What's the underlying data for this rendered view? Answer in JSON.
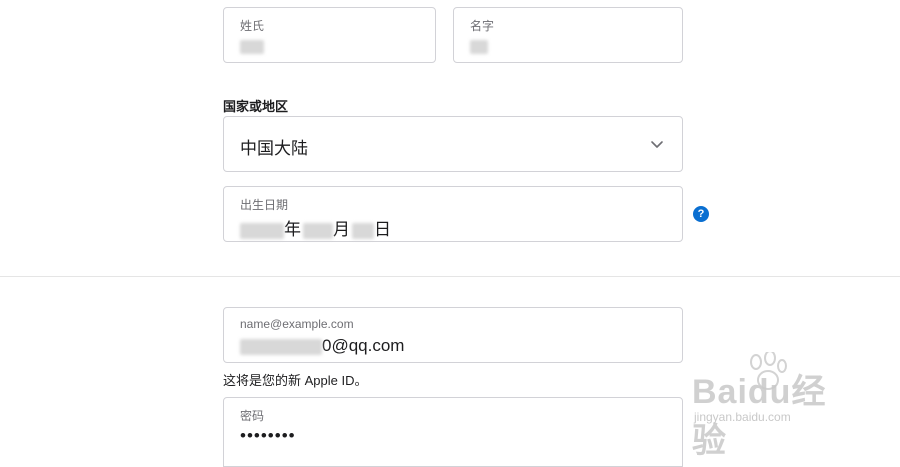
{
  "name_row": {
    "last_name_label": "姓氏",
    "first_name_label": "名字"
  },
  "country": {
    "label": "国家或地区",
    "selected": "中国大陆"
  },
  "birthday": {
    "label": "出生日期",
    "year_suffix": "年",
    "month_suffix": "月",
    "day_suffix": "日"
  },
  "email": {
    "placeholder_label": "name@example.com",
    "value_visible": "0@qq.com",
    "hint": "这将是您的新 Apple ID。"
  },
  "password": {
    "label": "密码",
    "value_masked": "••••••••"
  },
  "icons": {
    "help": "question-mark-icon",
    "dropdown": "chevron-down-icon"
  },
  "help": {
    "glyph": "?"
  },
  "watermark": {
    "brand": "Baidu经验",
    "url": "jingyan.baidu.com"
  },
  "colors": {
    "accent": "#0a6fd1",
    "border": "#d2d2d7"
  }
}
